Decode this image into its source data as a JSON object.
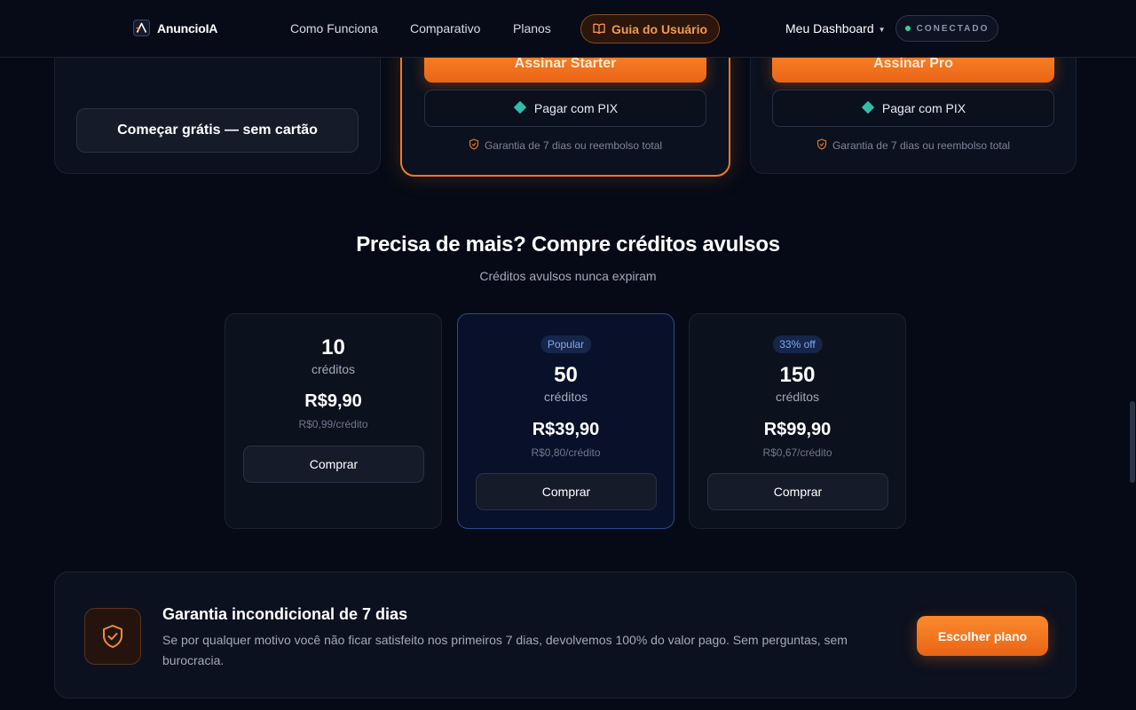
{
  "navbar": {
    "brand": "AnuncioIA",
    "links": [
      "Como Funciona",
      "Comparativo",
      "Planos"
    ],
    "guide_label": "Guia do Usuário",
    "dashboard_label": "Meu Dashboard",
    "status_label": "CONECTADO"
  },
  "plans": {
    "free_cta": "Começar grátis — sem cartão",
    "starter_cta": "Assinar Starter",
    "pro_cta": "Assinar Pro",
    "pix_label": "Pagar com PIX",
    "guarantee_note": "Garantia de 7 dias ou reembolso total"
  },
  "credits": {
    "title": "Precisa de mais? Compre créditos avulsos",
    "subtitle": "Créditos avulsos nunca expiram",
    "packs": [
      {
        "badge": "",
        "amount": "10",
        "unit": "créditos",
        "price": "R$9,90",
        "per_credit": "R$0,99/crédito",
        "buy_label": "Comprar"
      },
      {
        "badge": "Popular",
        "amount": "50",
        "unit": "créditos",
        "price": "R$39,90",
        "per_credit": "R$0,80/crédito",
        "buy_label": "Comprar"
      },
      {
        "badge": "33% off",
        "amount": "150",
        "unit": "créditos",
        "price": "R$99,90",
        "per_credit": "R$0,67/crédito",
        "buy_label": "Comprar"
      }
    ]
  },
  "guarantee": {
    "title": "Garantia incondicional de 7 dias",
    "text": "Se por qualquer motivo você não ficar satisfeito nos primeiros 7 dias, devolvemos 100% do valor pago. Sem perguntas, sem burocracia.",
    "cta": "Escolher plano"
  },
  "colors": {
    "accent": "#f07a22",
    "background": "#050a16",
    "card": "#0b111e",
    "featured_border": "#2a4c8c",
    "status_dot": "#2fd3a0"
  },
  "icons": {
    "logo": "anuncioia-logo-icon",
    "guide": "book-icon",
    "dashboard": "chevron-down-icon",
    "pix": "pix-icon",
    "guarantee": "shield-check-icon"
  }
}
